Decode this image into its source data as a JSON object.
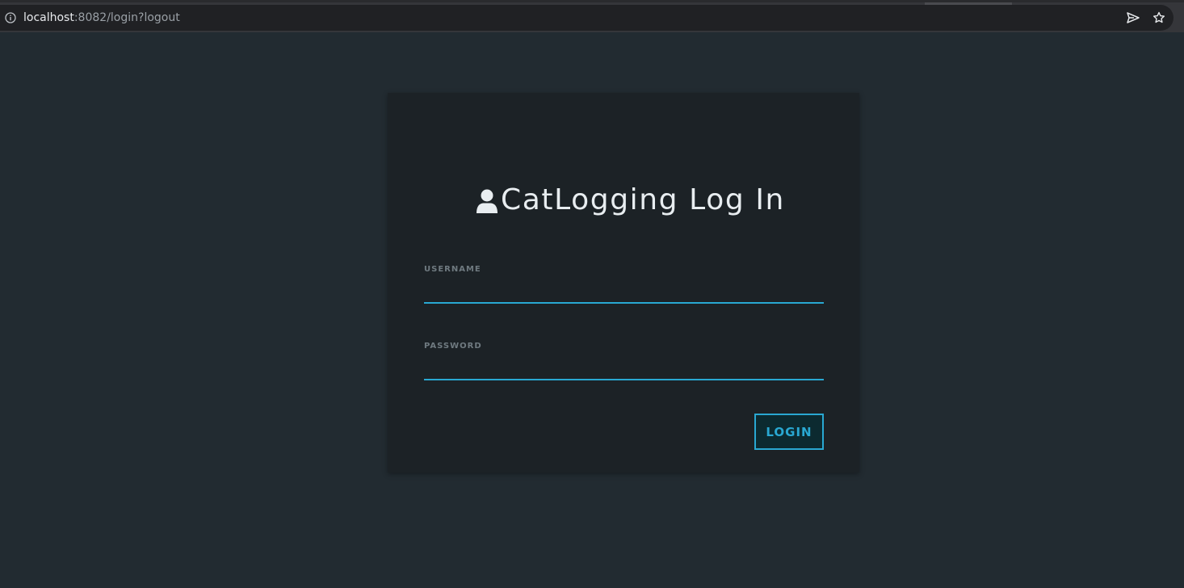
{
  "browser": {
    "url_host": "localhost",
    "url_rest": ":8082/login?logout",
    "icons": {
      "info": "info-icon",
      "send": "send-icon",
      "star": "star-icon"
    }
  },
  "login": {
    "title": "CatLogging Log In",
    "title_icon": "user-icon",
    "username_label": "USERNAME",
    "username_value": "",
    "password_label": "PASSWORD",
    "password_value": "",
    "button_label": "LOGIN"
  },
  "colors": {
    "page_background": "#222b31",
    "card_background": "#1c2226",
    "accent": "#29a8d2",
    "title_text": "#e8edf0",
    "label_text": "#6f7a80"
  }
}
